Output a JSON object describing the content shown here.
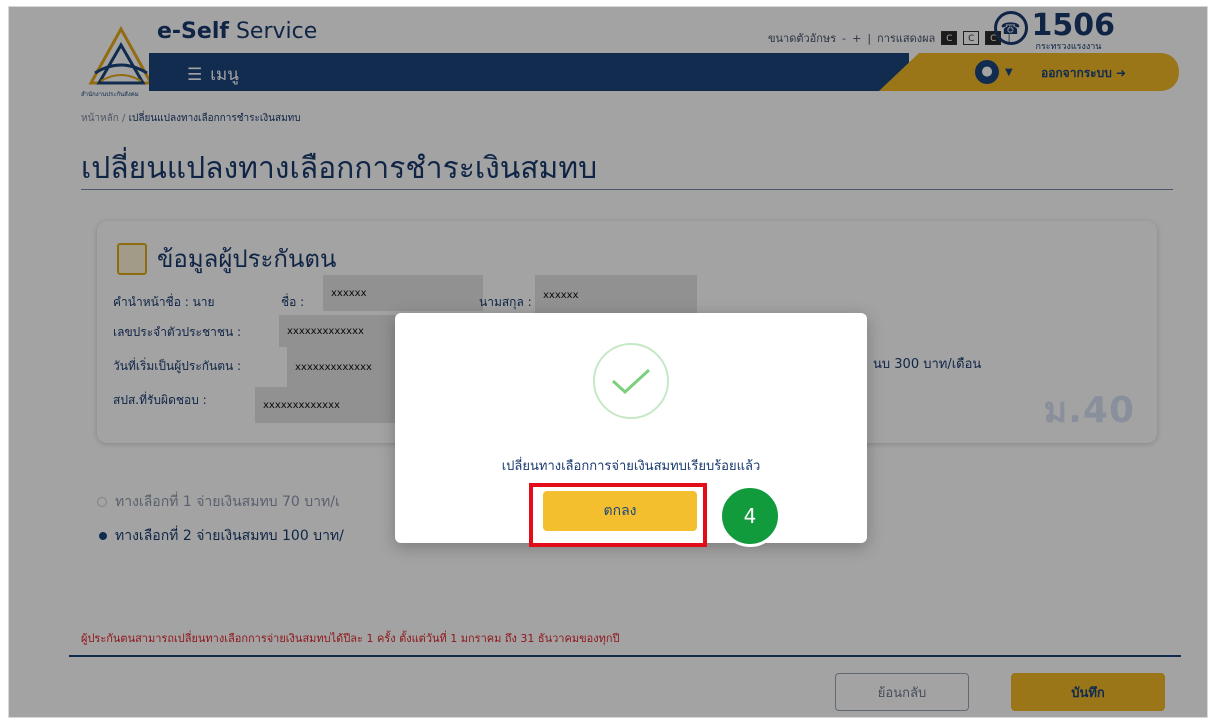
{
  "header": {
    "brand_bold": "e-Self",
    "brand_light": "Service",
    "font_size_label": "ขนาดตัวอักษร",
    "font_minus": "-",
    "font_plus": "+",
    "separator": "|",
    "display_label": "การแสดงผล",
    "contrast_options": [
      "C",
      "C",
      "C"
    ],
    "hotline_number": "1506",
    "hotline_sub": "กระทรวงแรงงาน",
    "menu_label": "เมนู",
    "logout_label": "ออกจากระบบ",
    "logo_caption": "สำนักงานประกันสังคม"
  },
  "breadcrumb": {
    "home": "หน้าหลัก",
    "sep": "/",
    "current": "เปลี่ยนแปลงทางเลือกการชำระเงินสมทบ"
  },
  "page_title": "เปลี่ยนแปลงทางเลือกการชำระเงินสมทบ",
  "insured_card": {
    "title": "ข้อมูลผู้ประกันตน",
    "prefix_label": "คำนำหน้าชื่อ : นาย",
    "first_name_label": "ชื่อ :",
    "first_name_value": "xxxxxx",
    "last_name_label": "นามสกุล :",
    "last_name_value": "xxxxxx",
    "citizen_id_label": "เลขประจำตัวประชาชน :",
    "citizen_id_value": "xxxxxxxxxxxxx",
    "start_date_label": "วันที่เริ่มเป็นผู้ประกันตน :",
    "start_date_value": "xxxxxxxxxxxxx",
    "branch_label": "สปส.ที่รับผิดชอบ :",
    "branch_value": "xxxxxxxxxxxxx",
    "fee_text": "นบ 300 บาท/เดือน",
    "section_watermark": "ม.40"
  },
  "options": [
    {
      "label": "ทางเลือกที่ 1 จ่ายเงินสมทบ 70 บาท/เ",
      "selected": false
    },
    {
      "label": "ทางเลือกที่ 2 จ่ายเงินสมทบ 100 บาท/",
      "selected": true
    }
  ],
  "note": "ผู้ประกันตนสามารถเปลี่ยนทางเลือกการจ่ายเงินสมทบได้ปีละ 1 ครั้ง ตั้งแต่วันที่ 1 มกราคม ถึง 31 ธันวาคมของทุกปี",
  "buttons": {
    "back": "ย้อนกลับ",
    "save": "บันทึก"
  },
  "modal": {
    "message": "เปลี่ยนทางเลือกการจ่ายเงินสมทบเรียบร้อยแล้ว",
    "ok": "ตกลง",
    "step_number": "4"
  },
  "colors": {
    "navy": "#1b467c",
    "gold": "#f1b928",
    "highlight_red": "#e30d1a",
    "step_green": "#119b3c",
    "success_check": "#7ccf7c"
  }
}
